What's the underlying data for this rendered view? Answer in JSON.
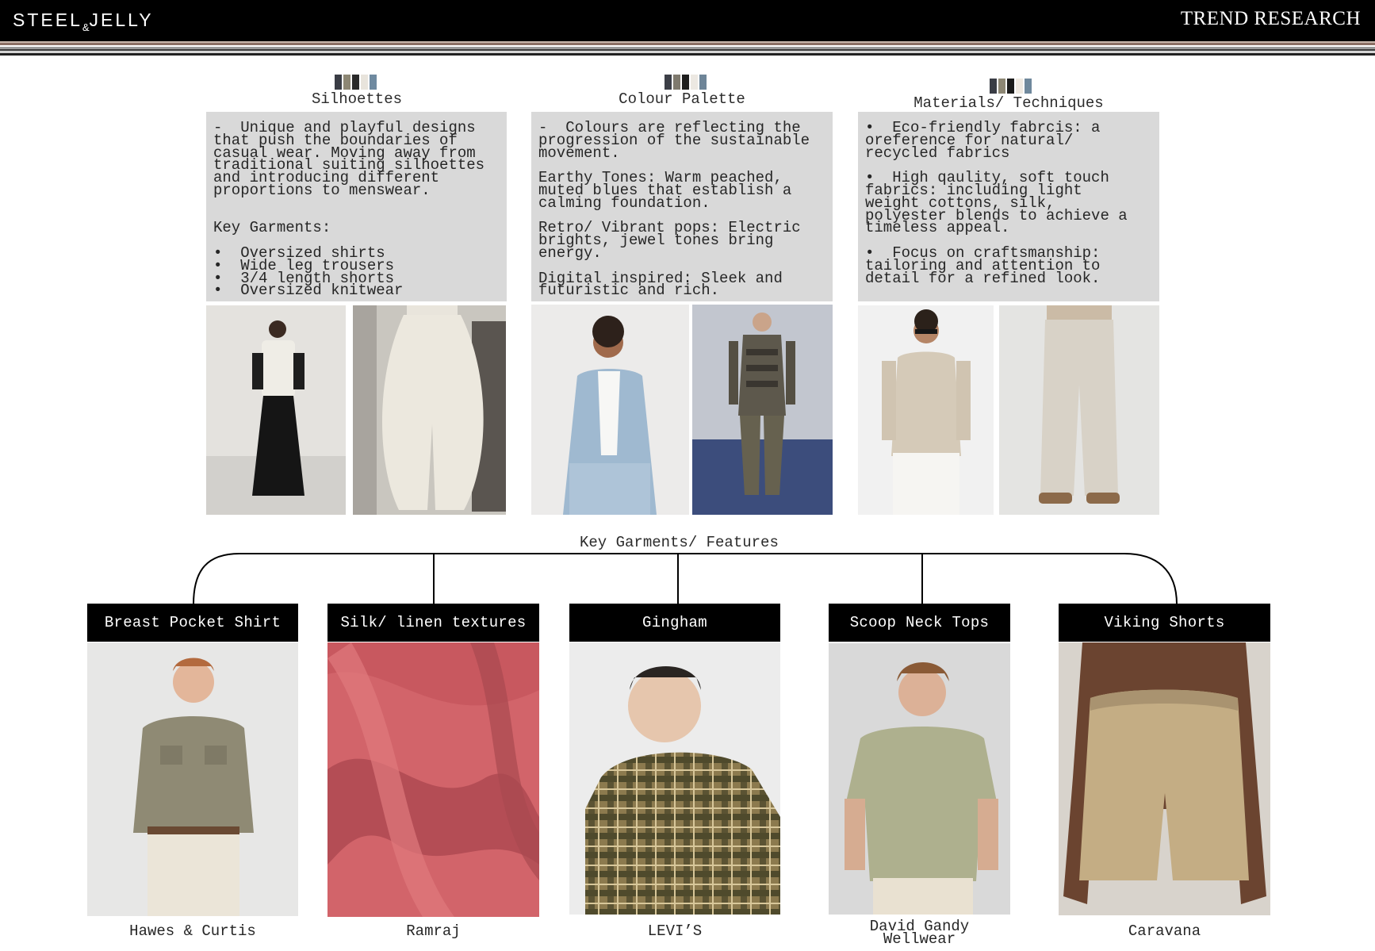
{
  "header": {
    "brand_main": "STEEL",
    "brand_amp": "&",
    "brand_tail": "JELLY",
    "title": "TREND RESEARCH"
  },
  "colors": {
    "header_bg": "#000000",
    "textbox_bg": "#d9d9d9",
    "stripes": [
      "#c9b8ad",
      "#8b6f64",
      "#ffffff",
      "#9a9a9a",
      "#3d3d3d",
      "#d6d6d6",
      "#222222"
    ]
  },
  "columns": [
    {
      "title": "Silhoettes",
      "swatches": [
        "#3a3d45",
        "#8d8774",
        "#2a2a2a",
        "#e8e4dc",
        "#6f8aa0"
      ],
      "text": "-  Unique and playful designs\nthat push the boundaries of\ncasual wear. Moving away from\ntraditional suiting silhoettes\nand introducing different\nproportions to menswear.\n\n\nKey Garments:\n\n•  Oversized shirts\n•  Wide leg trousers\n•  3/4 length shorts\n•  Oversized knitwear",
      "images": [
        "runway-oversized-shirt-wide-trousers",
        "wide-leg-cream-trousers"
      ]
    },
    {
      "title": "Colour Palette",
      "swatches": [
        "#3c3f47",
        "#7f7a6e",
        "#1f1f1f",
        "#ece8e2",
        "#6e8598"
      ],
      "text": "-  Colours are reflecting the\nprogression of the sustainable\nmovement.\n\nEarthy Tones: Warm peached,\nmuted blues that establish a\ncalming foundation.\n\nRetro/ Vibrant pops: Electric\nbrights, jewel tones bring\nenergy.\n\nDigital inspired: Sleek and\nfuturistic and rich.",
      "images": [
        "light-blue-linen-suit",
        "futuristic-runway-harness"
      ]
    },
    {
      "title": "Materials/ Techniques",
      "swatches": [
        "#3a3d45",
        "#8d8774",
        "#1b1b1b",
        "#efe9e1",
        "#6f889c"
      ],
      "text": "•  Eco-friendly fabrcis: a\noreference for natural/\nrecycled fabrics\n\n•  High qaulity, soft touch\nfabrics: including light\nweight cottons, silk,\npolyester blends to achieve a\ntimeless appeal.\n\n•  Focus on craftsmanship:\ntailoring and attention to\ndetail for a refined look.",
      "images": [
        "linen-shirt-sunglasses",
        "linen-drawstring-trousers"
      ]
    }
  ],
  "features": {
    "title": "Key Garments/ Features",
    "items": [
      {
        "label": "Breast Pocket Shirt",
        "brand": "Hawes & Curtis",
        "image": "olive-breast-pocket-shirt"
      },
      {
        "label": "Silk/ linen textures",
        "brand": "Ramraj",
        "image": "pink-silk-fabric"
      },
      {
        "label": "Gingham",
        "brand": "LEVI’S",
        "image": "plaid-gingham-shirt"
      },
      {
        "label": "Scoop Neck Tops",
        "brand": "David Gandy\nWellwear",
        "image": "sage-scoop-neck-tee"
      },
      {
        "label": "Viking Shorts",
        "brand": "Caravana",
        "image": "textured-linen-shorts"
      }
    ]
  }
}
